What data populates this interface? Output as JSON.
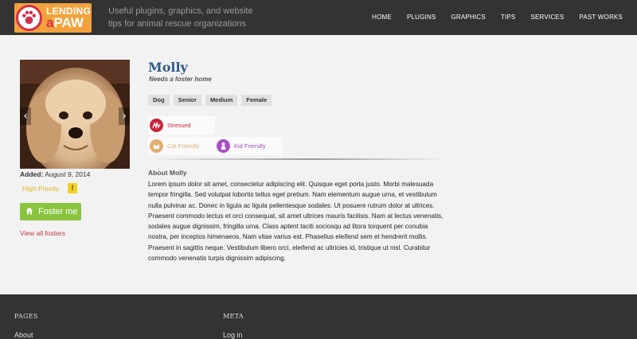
{
  "brand": {
    "logo_line1": "LENDING",
    "logo_a": "a",
    "logo_paw": "PAW",
    "tagline": "Useful plugins, graphics, and website tips for animal rescue organizations",
    "logo_icon": "paw-icon"
  },
  "nav": {
    "items": [
      "HOME",
      "PLUGINS",
      "GRAPHICS",
      "TIPS",
      "SERVICES",
      "PAST WORKS"
    ]
  },
  "pet": {
    "name": "Molly",
    "subtitle": "Needs a foster home",
    "added_label": "Added:",
    "added_date": "August 9, 2014",
    "priority_label": "High Priority",
    "priority_badge": "!",
    "tags": [
      "Dog",
      "Senior",
      "Medium",
      "Female"
    ],
    "traits": [
      {
        "label": "Stressed",
        "icon": "stress-icon",
        "color": "#c8243c"
      },
      {
        "label": "Cat Friendly",
        "icon": "cat-icon",
        "color": "#e1ad72"
      },
      {
        "label": "Kid Friendly",
        "icon": "kid-icon",
        "color": "#a64fc2"
      }
    ],
    "about_title": "About Molly",
    "about_text": "Lorem ipsum dolor sit amet, consectetur adipiscing elit. Quisque eget porta justo. Morbi malesuada tempor fringilla. Sed volutpat lobortis tellus eget pretium. Nam elementum augue urna, et vestibulum nulla pulvinar ac. Donec in ligula ac ligula pellentesque sodales. Ut posuere rutrum dolor at ultrices. Praesent commodo lectus et orci consequat, sit amet ultrices mauris facilisis. Nam at lectus venenatis, sodales augue dignissim, fringilla urna. Class aptent taciti sociosqu ad litora torquent per conubia nostra, per inceptos himenaeos. Nam vitae varius est. Phasellus eleifend sem et hendrerit mollis. Praesent in sagittis neque. Vestibulum libero orci, eleifend ac ultricies id, tristique ut nisl. Curabitur commodo venenatis turpis dignissim adipiscing."
  },
  "actions": {
    "foster_label": "Foster me",
    "view_all_label": "View all fosters",
    "prev_arrow": "‹",
    "next_arrow": "›"
  },
  "footer": {
    "pages_heading": "PAGES",
    "pages_link": "About",
    "meta_heading": "META",
    "meta_link": "Log in"
  },
  "colors": {
    "header_bg": "#333333",
    "page_bg": "#f2f2f2",
    "name_color": "#2e5a87",
    "foster_button": "#8ac43f",
    "priority": "#e4b422",
    "link_red": "#c23b3b"
  }
}
